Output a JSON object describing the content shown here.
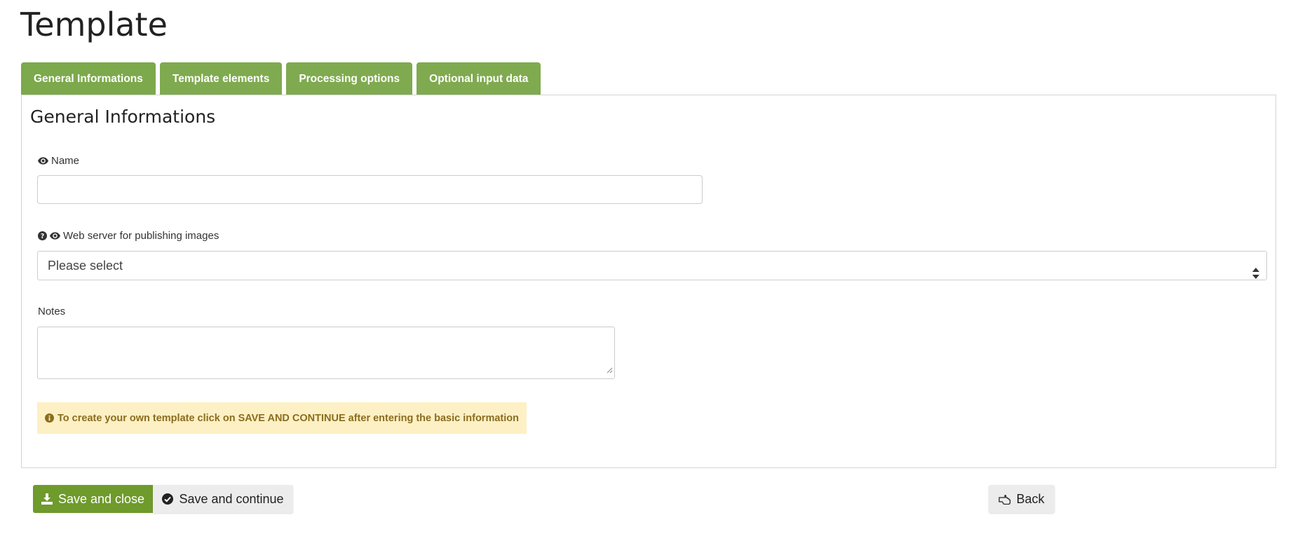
{
  "page": {
    "title": "Template"
  },
  "tabs": [
    {
      "label": "General Informations"
    },
    {
      "label": "Template elements"
    },
    {
      "label": "Processing options"
    },
    {
      "label": "Optional input data"
    }
  ],
  "panel": {
    "title": "General Informations",
    "name_field": {
      "label": "Name",
      "value": "",
      "icon": "eye-icon"
    },
    "webserver_field": {
      "label": "Web server for publishing images",
      "selected": "Please select",
      "icons": [
        "question-circle-icon",
        "eye-icon"
      ]
    },
    "notes_field": {
      "label": "Notes",
      "value": ""
    },
    "alert": {
      "text": "To create your own template click on SAVE AND CONTINUE after entering the basic information",
      "icon": "info-circle-icon"
    }
  },
  "actions": {
    "save_close": {
      "label": "Save and close",
      "icon": "download-icon"
    },
    "save_continue": {
      "label": "Save and continue",
      "icon": "check-circle-icon"
    },
    "back": {
      "label": "Back",
      "icon": "hand-pointer-left-icon"
    }
  },
  "colors": {
    "tab_green": "#7faa4f",
    "primary_green": "#6f9a2c",
    "alert_bg": "#fdf0c5",
    "alert_text": "#8a6d1e"
  }
}
